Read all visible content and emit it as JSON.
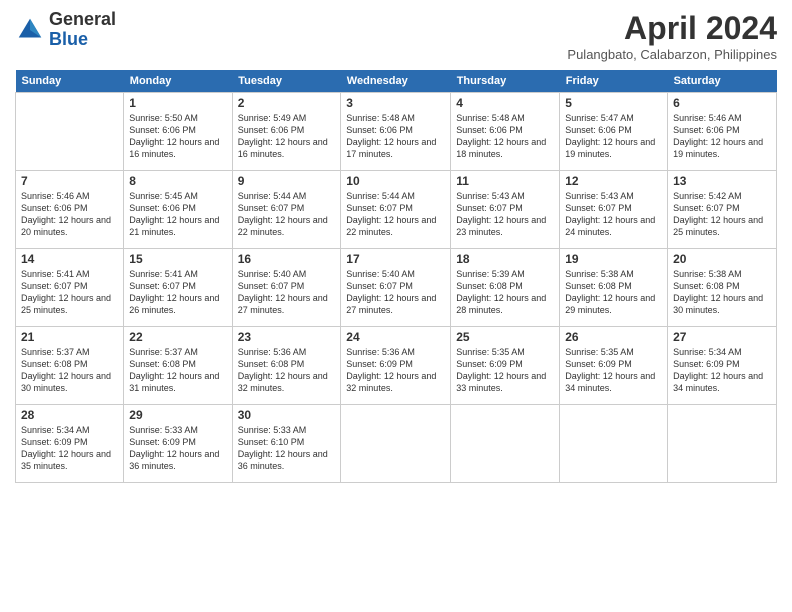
{
  "header": {
    "logo_line1": "General",
    "logo_line2": "Blue",
    "month": "April 2024",
    "location": "Pulangbato, Calabarzon, Philippines"
  },
  "days_of_week": [
    "Sunday",
    "Monday",
    "Tuesday",
    "Wednesday",
    "Thursday",
    "Friday",
    "Saturday"
  ],
  "weeks": [
    [
      {
        "day": "",
        "info": ""
      },
      {
        "day": "1",
        "info": "Sunrise: 5:50 AM\nSunset: 6:06 PM\nDaylight: 12 hours\nand 16 minutes."
      },
      {
        "day": "2",
        "info": "Sunrise: 5:49 AM\nSunset: 6:06 PM\nDaylight: 12 hours\nand 16 minutes."
      },
      {
        "day": "3",
        "info": "Sunrise: 5:48 AM\nSunset: 6:06 PM\nDaylight: 12 hours\nand 17 minutes."
      },
      {
        "day": "4",
        "info": "Sunrise: 5:48 AM\nSunset: 6:06 PM\nDaylight: 12 hours\nand 18 minutes."
      },
      {
        "day": "5",
        "info": "Sunrise: 5:47 AM\nSunset: 6:06 PM\nDaylight: 12 hours\nand 19 minutes."
      },
      {
        "day": "6",
        "info": "Sunrise: 5:46 AM\nSunset: 6:06 PM\nDaylight: 12 hours\nand 19 minutes."
      }
    ],
    [
      {
        "day": "7",
        "info": ""
      },
      {
        "day": "8",
        "info": "Sunrise: 5:45 AM\nSunset: 6:06 PM\nDaylight: 12 hours\nand 21 minutes."
      },
      {
        "day": "9",
        "info": "Sunrise: 5:44 AM\nSunset: 6:07 PM\nDaylight: 12 hours\nand 22 minutes."
      },
      {
        "day": "10",
        "info": "Sunrise: 5:44 AM\nSunset: 6:07 PM\nDaylight: 12 hours\nand 22 minutes."
      },
      {
        "day": "11",
        "info": "Sunrise: 5:43 AM\nSunset: 6:07 PM\nDaylight: 12 hours\nand 23 minutes."
      },
      {
        "day": "12",
        "info": "Sunrise: 5:43 AM\nSunset: 6:07 PM\nDaylight: 12 hours\nand 24 minutes."
      },
      {
        "day": "13",
        "info": "Sunrise: 5:42 AM\nSunset: 6:07 PM\nDaylight: 12 hours\nand 25 minutes."
      }
    ],
    [
      {
        "day": "14",
        "info": ""
      },
      {
        "day": "15",
        "info": "Sunrise: 5:41 AM\nSunset: 6:07 PM\nDaylight: 12 hours\nand 26 minutes."
      },
      {
        "day": "16",
        "info": "Sunrise: 5:40 AM\nSunset: 6:07 PM\nDaylight: 12 hours\nand 27 minutes."
      },
      {
        "day": "17",
        "info": "Sunrise: 5:40 AM\nSunset: 6:07 PM\nDaylight: 12 hours\nand 27 minutes."
      },
      {
        "day": "18",
        "info": "Sunrise: 5:39 AM\nSunset: 6:08 PM\nDaylight: 12 hours\nand 28 minutes."
      },
      {
        "day": "19",
        "info": "Sunrise: 5:38 AM\nSunset: 6:08 PM\nDaylight: 12 hours\nand 29 minutes."
      },
      {
        "day": "20",
        "info": "Sunrise: 5:38 AM\nSunset: 6:08 PM\nDaylight: 12 hours\nand 30 minutes."
      }
    ],
    [
      {
        "day": "21",
        "info": ""
      },
      {
        "day": "22",
        "info": "Sunrise: 5:37 AM\nSunset: 6:08 PM\nDaylight: 12 hours\nand 31 minutes."
      },
      {
        "day": "23",
        "info": "Sunrise: 5:36 AM\nSunset: 6:08 PM\nDaylight: 12 hours\nand 32 minutes."
      },
      {
        "day": "24",
        "info": "Sunrise: 5:36 AM\nSunset: 6:09 PM\nDaylight: 12 hours\nand 32 minutes."
      },
      {
        "day": "25",
        "info": "Sunrise: 5:35 AM\nSunset: 6:09 PM\nDaylight: 12 hours\nand 33 minutes."
      },
      {
        "day": "26",
        "info": "Sunrise: 5:35 AM\nSunset: 6:09 PM\nDaylight: 12 hours\nand 34 minutes."
      },
      {
        "day": "27",
        "info": "Sunrise: 5:34 AM\nSunset: 6:09 PM\nDaylight: 12 hours\nand 34 minutes."
      }
    ],
    [
      {
        "day": "28",
        "info": "Sunrise: 5:34 AM\nSunset: 6:09 PM\nDaylight: 12 hours\nand 35 minutes."
      },
      {
        "day": "29",
        "info": "Sunrise: 5:33 AM\nSunset: 6:09 PM\nDaylight: 12 hours\nand 36 minutes."
      },
      {
        "day": "30",
        "info": "Sunrise: 5:33 AM\nSunset: 6:10 PM\nDaylight: 12 hours\nand 36 minutes."
      },
      {
        "day": "",
        "info": ""
      },
      {
        "day": "",
        "info": ""
      },
      {
        "day": "",
        "info": ""
      },
      {
        "day": "",
        "info": ""
      }
    ]
  ],
  "week7_day7_special": "Sunrise: 5:46 AM\nSunset: 6:06 PM\nDaylight: 12 hours\nand 20 minutes.",
  "week14_day14_special": "Sunrise: 5:41 AM\nSunset: 6:07 PM\nDaylight: 12 hours\nand 25 minutes.",
  "week21_day21_special": "Sunrise: 5:37 AM\nSunset: 6:08 PM\nDaylight: 12 hours\nand 30 minutes."
}
